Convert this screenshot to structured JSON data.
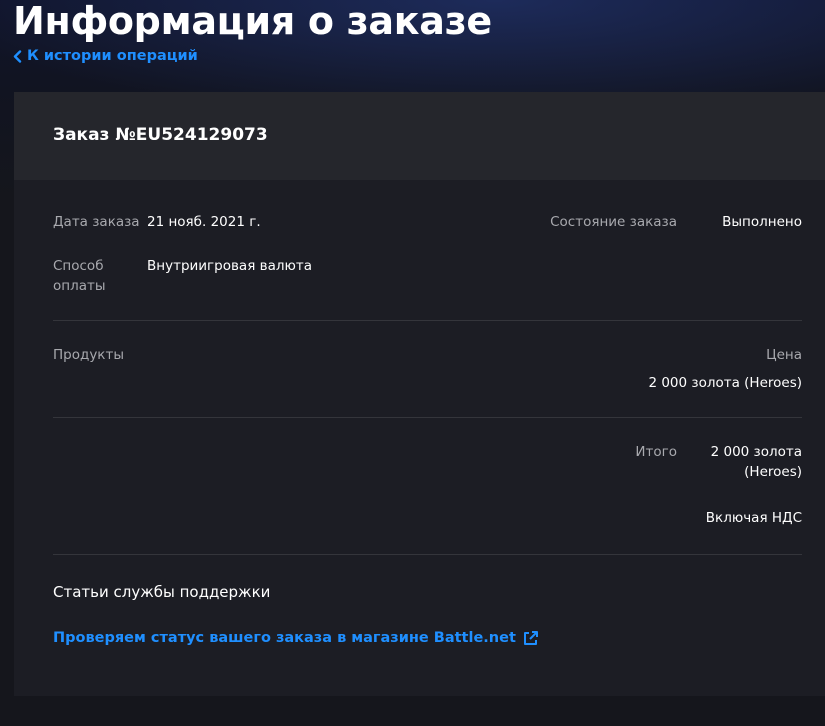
{
  "header": {
    "title": "Информация о заказе",
    "back_link": "К истории операций"
  },
  "order": {
    "number": "Заказ №EU524129073",
    "date_label": "Дата заказа",
    "date_value": "21 нояб. 2021 г.",
    "status_label": "Состояние заказа",
    "status_value": "Выполнено",
    "payment_label_line1": "Способ",
    "payment_label_line2": "оплаты",
    "payment_value": "Внутриигровая валюта"
  },
  "products": {
    "header_label": "Продукты",
    "price_label": "Цена",
    "items": [
      {
        "price": "2 000 золота (Heroes)"
      }
    ]
  },
  "totals": {
    "label": "Итого",
    "value_line1": "2 000 золота",
    "value_line2": "(Heroes)",
    "vat_note": "Включая НДС"
  },
  "support": {
    "title": "Статьи службы поддержки",
    "link_text": "Проверяем статус вашего заказа в магазине Battle.net"
  },
  "icons": {
    "back": "chevron-left-icon",
    "external": "external-link-icon"
  },
  "colors": {
    "accent": "#1f8fff",
    "card": "#1c1d24",
    "card_header": "#25262c",
    "label": "#a8a9ae"
  }
}
